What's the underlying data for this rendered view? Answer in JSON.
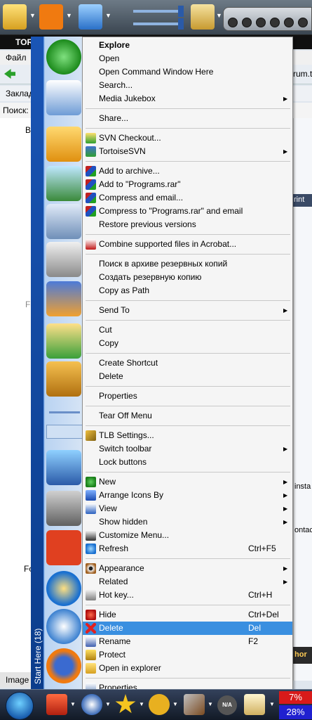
{
  "background": {
    "title": "TOR",
    "menu_file": "Файл",
    "bookmarks": "Заклад",
    "search": "Поиск:",
    "url_fragment": "rum.t",
    "right_print": "rint",
    "right_install": "insta",
    "right_contact": "ontac",
    "right_chor": "hor",
    "tree_fa": "Fa",
    "tree_fo": "Fo",
    "tree_b": "B",
    "status": "Image"
  },
  "sidebar": {
    "caption": "Start Here (18)"
  },
  "menu": {
    "groups": [
      [
        {
          "label": "Explore",
          "bold": true
        },
        {
          "label": "Open"
        },
        {
          "label": "Open Command Window Here"
        },
        {
          "label": "Search..."
        },
        {
          "label": "Media Jukebox",
          "submenu": true
        }
      ],
      [
        {
          "label": "Share..."
        }
      ],
      [
        {
          "label": "SVN Checkout...",
          "icon": "svn-checkout-icon"
        },
        {
          "label": "TortoiseSVN",
          "icon": "tortoisesvn-icon",
          "submenu": true
        }
      ],
      [
        {
          "label": "Add to archive...",
          "icon": "winrar-icon"
        },
        {
          "label": "Add to \"Programs.rar\"",
          "icon": "winrar-icon"
        },
        {
          "label": "Compress and email...",
          "icon": "winrar-icon"
        },
        {
          "label": "Compress to \"Programs.rar\" and email",
          "icon": "winrar-icon"
        },
        {
          "label": "Restore previous versions"
        }
      ],
      [
        {
          "label": "Combine supported files in Acrobat...",
          "icon": "acrobat-icon"
        }
      ],
      [
        {
          "label": "Поиск в архиве резервных копий"
        },
        {
          "label": "Создать резервную копию"
        },
        {
          "label": "Copy as Path"
        }
      ],
      [
        {
          "label": "Send To",
          "submenu": true
        }
      ],
      [
        {
          "label": "Cut"
        },
        {
          "label": "Copy"
        }
      ],
      [
        {
          "label": "Create Shortcut"
        },
        {
          "label": "Delete"
        }
      ],
      [
        {
          "label": "Properties"
        }
      ],
      [
        {
          "label": "Tear Off Menu"
        }
      ],
      [
        {
          "label": "TLB Settings...",
          "icon": "wrench-icon"
        },
        {
          "label": "Switch toolbar",
          "submenu": true
        },
        {
          "label": "Lock buttons"
        }
      ],
      [
        {
          "label": "New",
          "icon": "new-plus-icon",
          "submenu": true
        },
        {
          "label": "Arrange Icons By",
          "icon": "arrange-icon",
          "submenu": true
        },
        {
          "label": "View",
          "icon": "view-icon",
          "submenu": true
        },
        {
          "label": "Show hidden",
          "submenu": true
        },
        {
          "label": "Customize Menu...",
          "icon": "customize-icon"
        },
        {
          "label": "Refresh",
          "icon": "refresh-icon",
          "shortcut": "Ctrl+F5"
        }
      ],
      [
        {
          "label": "Appearance",
          "icon": "eye-icon",
          "submenu": true
        },
        {
          "label": "Related",
          "submenu": true
        },
        {
          "label": "Hot key...",
          "icon": "hotkey-icon",
          "shortcut": "Ctrl+H"
        }
      ],
      [
        {
          "label": "Hide",
          "icon": "hide-icon",
          "shortcut": "Ctrl+Del"
        },
        {
          "label": "Delete",
          "icon": "delete-x-icon",
          "shortcut": "Del",
          "highlighted": true
        },
        {
          "label": "Rename",
          "icon": "rename-icon",
          "shortcut": "F2"
        },
        {
          "label": "Protect",
          "icon": "lock-icon"
        },
        {
          "label": "Open in explorer",
          "icon": "folder-icon"
        }
      ],
      [
        {
          "label": "Properties",
          "icon": "properties-icon"
        }
      ]
    ]
  },
  "taskbar": {
    "na_badge": "N/A",
    "meter_top": "7%",
    "meter_bottom": "28%"
  },
  "colors": {
    "highlight": "#3a8fe0",
    "menu_bg": "#f5f5f5",
    "sidebar_strip": "#1a55b5",
    "meter_red": "#d81a1a",
    "meter_blue": "#2020d0"
  }
}
